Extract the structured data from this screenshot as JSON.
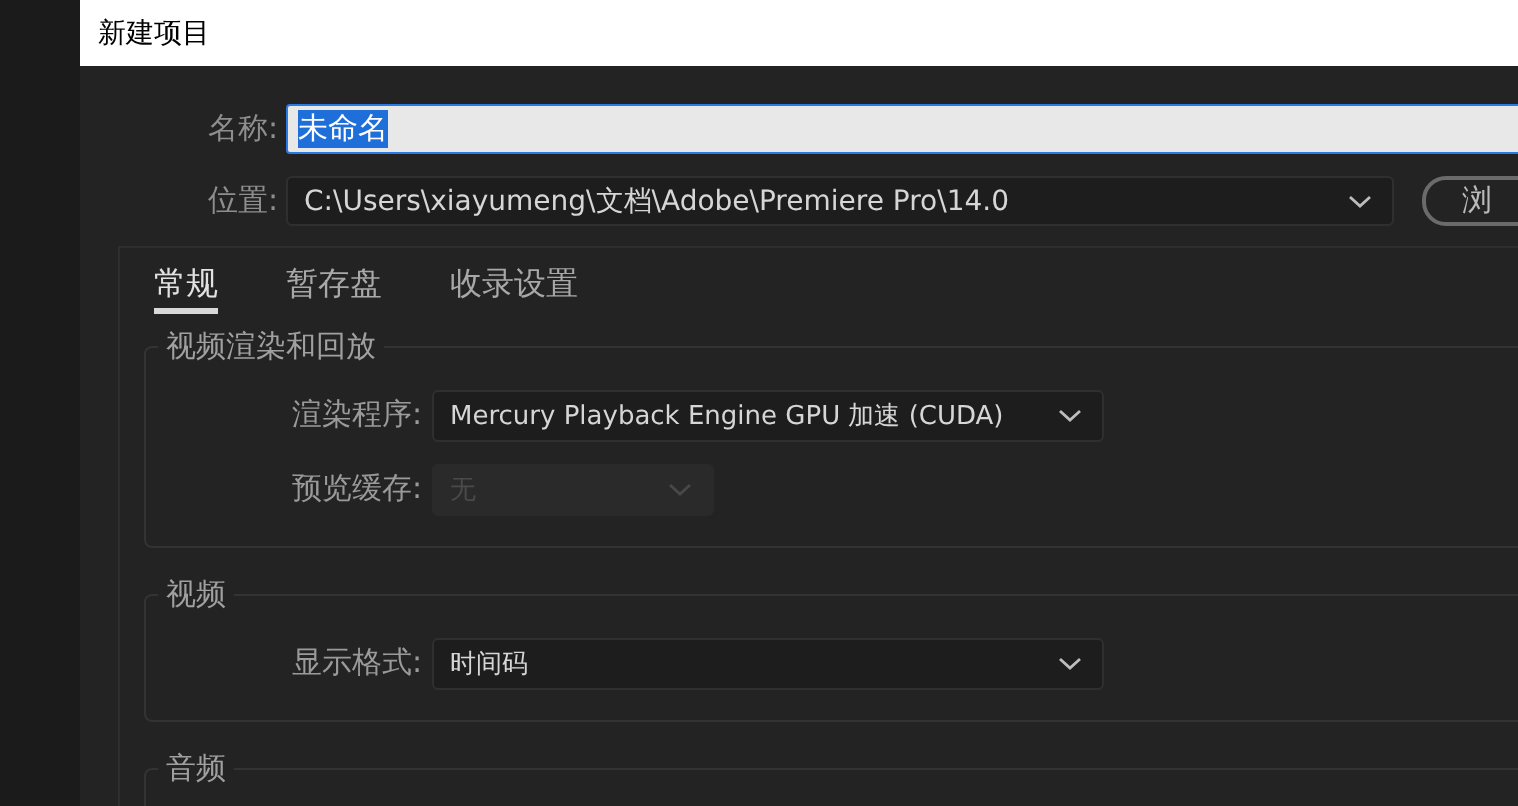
{
  "window": {
    "title": "新建项目"
  },
  "name_field": {
    "label": "名称:",
    "value": "未命名",
    "text_highlighted": true
  },
  "location_field": {
    "label": "位置:",
    "value": "C:\\Users\\xiayumeng\\文档\\Adobe\\Premiere Pro\\14.0"
  },
  "browse_button": {
    "label": "浏"
  },
  "tabs": [
    {
      "label": "常规",
      "selected": true
    },
    {
      "label": "暂存盘",
      "selected": false
    },
    {
      "label": "收录设置",
      "selected": false
    }
  ],
  "groups": [
    {
      "title": "视频渲染和回放",
      "rows": [
        {
          "kind": "dropdown",
          "label": "渲染程序:",
          "value": "Mercury Playback Engine GPU 加速 (CUDA)",
          "disabled": false
        },
        {
          "kind": "dropdown",
          "label": "预览缓存:",
          "value": "无",
          "disabled": true
        }
      ]
    },
    {
      "title": "视频",
      "rows": [
        {
          "kind": "dropdown",
          "label": "显示格式:",
          "value": "时间码",
          "disabled": false
        }
      ]
    },
    {
      "title": "音频"
    }
  ]
}
